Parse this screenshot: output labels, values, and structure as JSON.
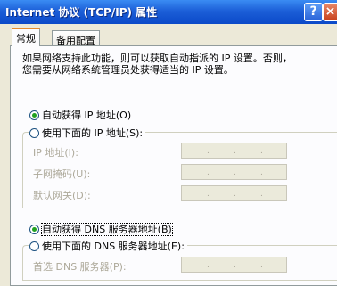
{
  "window": {
    "title": "Internet 协议 (TCP/IP) 属性",
    "help_label": "?",
    "close_label": "×"
  },
  "tabs": [
    {
      "label": "常规",
      "active": true
    },
    {
      "label": "备用配置",
      "active": false
    }
  ],
  "description": "如果网络支持此功能，则可以获取自动指派的 IP 设置。否则，\n您需要从网络系统管理员处获得适当的 IP 设置。",
  "ip_section": {
    "auto_label": "自动获得 IP 地址(O)",
    "auto_checked": true,
    "manual_label": "使用下面的 IP 地址(S):",
    "manual_checked": false,
    "fields": [
      {
        "label": "IP 地址(I):",
        "value": ""
      },
      {
        "label": "子网掩码(U):",
        "value": ""
      },
      {
        "label": "默认网关(D):",
        "value": ""
      }
    ]
  },
  "dns_section": {
    "auto_label": "自动获得 DNS 服务器地址(B)",
    "auto_checked": true,
    "manual_label": "使用下面的 DNS 服务器地址(E):",
    "manual_checked": false,
    "fields": [
      {
        "label": "首选 DNS 服务器(P):",
        "value": ""
      }
    ]
  },
  "ip_separator": "."
}
